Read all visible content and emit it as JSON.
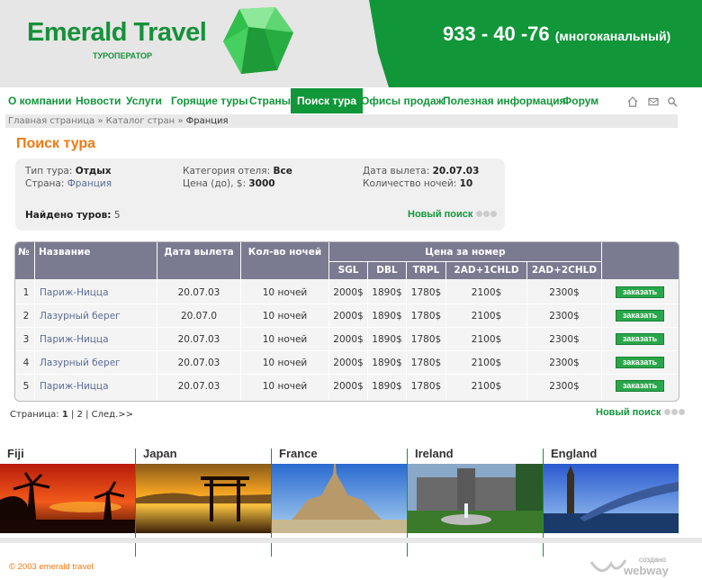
{
  "header": {
    "logo": "Emerald Travel",
    "subtitle": "ТУРОПЕРАТОР",
    "phone": "933 - 40 -76",
    "phone_note": "(многоканальный)"
  },
  "nav": {
    "items": [
      "О компании",
      "Новости",
      "Услуги",
      "Горящие туры",
      "Страны",
      "Поиск тура",
      "Офисы продаж",
      "Полезная информация",
      "Форум"
    ],
    "active_index": 5,
    "icons": [
      "home-icon",
      "mail-icon",
      "search-icon"
    ]
  },
  "breadcrumb": {
    "items": [
      "Главная страница",
      "Каталог стран",
      "Франция"
    ],
    "separator": "»"
  },
  "page_title": "Поиск тура",
  "filter": {
    "tour_type_label": "Тип тура:",
    "tour_type": "Отдых",
    "country_label": "Страна:",
    "country": "Франция",
    "hotel_cat_label": "Категория отеля:",
    "hotel_cat": "Все",
    "price_label": "Цена (до), $:",
    "price": "3000",
    "date_label": "Дата вылета:",
    "date": "20.07.03",
    "nights_label": "Количество ночей:",
    "nights": "10",
    "found_label": "Найдено туров:",
    "found": "5",
    "new_search": "Новый поиск"
  },
  "table": {
    "headers": {
      "num": "№",
      "name": "Название",
      "date": "Дата вылета",
      "nights": "Кол-во ночей",
      "price_group": "Цена за номер"
    },
    "price_cols": [
      "SGL",
      "DBL",
      "TRPL",
      "2AD+1CHLD",
      "2AD+2CHLD"
    ],
    "order_label": "заказать",
    "rows": [
      {
        "num": "1",
        "name": "Париж-Ницца",
        "date": "20.07.03",
        "nights": "10 ночей",
        "sgl": "2000$",
        "dbl": "1890$",
        "trpl": "1780$",
        "c1": "2100$",
        "c2": "2300$"
      },
      {
        "num": "2",
        "name": "Лазурный берег",
        "date": "20.07.0",
        "nights": "10 ночей",
        "sgl": "2000$",
        "dbl": "1890$",
        "trpl": "1780$",
        "c1": "2100$",
        "c2": "2300$"
      },
      {
        "num": "3",
        "name": "Париж-Ницца",
        "date": "20.07.03",
        "nights": "10 ночей",
        "sgl": "2000$",
        "dbl": "1890$",
        "trpl": "1780$",
        "c1": "2100$",
        "c2": "2300$"
      },
      {
        "num": "4",
        "name": "Лазурный берег",
        "date": "20.07.03",
        "nights": "10 ночей",
        "sgl": "2000$",
        "dbl": "1890$",
        "trpl": "1780$",
        "c1": "2100$",
        "c2": "2300$"
      },
      {
        "num": "5",
        "name": "Париж-Ницца",
        "date": "20.07.03",
        "nights": "10 ночей",
        "sgl": "2000$",
        "dbl": "1890$",
        "trpl": "1780$",
        "c1": "2100$",
        "c2": "2300$"
      }
    ]
  },
  "pager": {
    "label": "Страница:",
    "current": "1",
    "sep": "|",
    "page2": "2",
    "next": "След.>>",
    "new_search": "Новый поиск"
  },
  "destinations": [
    "Fiji",
    "Japan",
    "France",
    "Ireland",
    "England"
  ],
  "footer": {
    "copyright": "© 2003 emerald travel",
    "made_by": "создано",
    "brand": "webway"
  },
  "colors": {
    "green": "#12963a",
    "orange": "#ee7a11",
    "table_header": "#7a7a91",
    "link": "#5a6c96"
  }
}
